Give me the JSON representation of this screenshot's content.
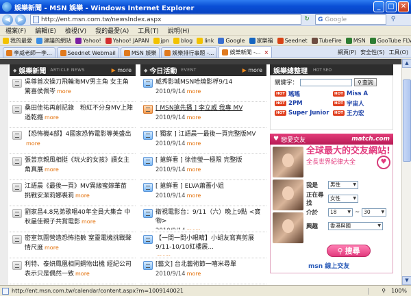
{
  "window": {
    "title": "娛樂新聞 - MSN 娛樂 - Windows Internet Explorer"
  },
  "address": {
    "url": "http://ent.msn.com.tw/newsIndex.aspx",
    "search_placeholder": "Google"
  },
  "menu": [
    "檔案(F)",
    "編輯(E)",
    "檢視(V)",
    "我的最愛(A)",
    "工具(T)",
    "說明(H)"
  ],
  "links": [
    {
      "label": "我的最愛",
      "color": "#f2c200"
    },
    {
      "label": "建議的網站",
      "color": "#3a8ee6"
    },
    {
      "label": "Yahoo!",
      "color": "#7b1fa2"
    },
    {
      "label": "Yahoo! JAPAN",
      "color": "#d32f2f"
    },
    {
      "label": "jpn",
      "color": "#f2c200"
    },
    {
      "label": "blog",
      "color": "#f2c200"
    },
    {
      "label": "link",
      "color": "#f2c200"
    },
    {
      "label": "Google",
      "color": "#3a6fd0"
    },
    {
      "label": "家樂福",
      "color": "#1565c0"
    },
    {
      "label": "Seednet",
      "color": "#d84315"
    },
    {
      "label": "TubeFire",
      "color": "#6d4c41"
    },
    {
      "label": "MSN",
      "color": "#2e7d32"
    },
    {
      "label": "GooTube FLV",
      "color": "#2e7d32"
    }
  ],
  "tabs": [
    {
      "label": "李威老師一李...",
      "active": false
    },
    {
      "label": "Seednet Webmail",
      "active": false
    },
    {
      "label": "MSN 娛樂",
      "active": false
    },
    {
      "label": "娛樂排行事題 -...",
      "active": false
    },
    {
      "label": "娛樂新聞 -...",
      "active": true
    }
  ],
  "tabtools": [
    "網頁(P)",
    "安全性(S)",
    "工具(O)"
  ],
  "news": {
    "title": "娛樂新聞",
    "sub": "ARTICLE NEWS",
    "more": "more",
    "items": [
      {
        "title": "吳尊首次操刀飛輪海MV男主角 女主角驚喜侯佩岑",
        "icon": "grey"
      },
      {
        "title": "桑田佳祐再創記錄　粉紅不分身MV上陣過乾癮",
        "icon": "grey"
      },
      {
        "title": "【恐怖機4部】4國家恐怖電影等美盛出",
        "icon": "grey"
      },
      {
        "title": "張芸京親風相挺《玩火的女孩》讀女主角真展",
        "icon": "grey"
      },
      {
        "title": "江語晨《最後一頁》MV異緣蜜嫁華苗 挑戰安潔莉娜裘莉",
        "icon": "grey"
      },
      {
        "title": "劉家昌4.8兄弟歌唱40年全員大集合 中秋最佳親子共賞電影",
        "icon": "grey"
      },
      {
        "title": "密室氛圍營造恐怖指數 窒靈電機挑戰聲情尺度",
        "icon": "grey"
      },
      {
        "title": "利特、泰妍鳳凰相同鋼物出機 經紀公司表示只是偶然一致",
        "icon": "grey"
      }
    ]
  },
  "events": {
    "title": "今日活動",
    "sub": "EVENT",
    "more": "more",
    "items": [
      {
        "title": "威秀影城MSN哈燒影桴9/14",
        "date": "2010/9/14",
        "icon": "blue",
        "link": false
      },
      {
        "title": "[ MSN搶先播 ] 李立威 我專 MV",
        "date": "2010/9/14",
        "icon": "orange",
        "link": true
      },
      {
        "title": "[ 獨家 ] 江語晨一最後一頁完整版MV",
        "date": "2010/9/14",
        "icon": "blue",
        "link": false
      },
      {
        "title": "[ 搶鮮看 ] 徐佳瑩一極限 完整版",
        "date": "2010/9/14",
        "icon": "blue",
        "link": false
      },
      {
        "title": "[ 搶鮮看 ] ELVA蕭薔小姐",
        "date": "2010/9/14",
        "icon": "blue",
        "link": false
      },
      {
        "title": "衛視電影台：9/11（六）晚上9點 <寶物>",
        "date": "2010/9/14",
        "icon": "blue",
        "link": false
      },
      {
        "title": "【一問一問小眼睛】小胡友寫真剪展9/11-10/10紅樓展...",
        "date": "",
        "icon": "blue",
        "link": false
      },
      {
        "title": "[藝文] 台北藝術節一嘻米尋單",
        "date": "2010/9/14",
        "icon": "blue",
        "link": false
      }
    ]
  },
  "ent": {
    "title": "娛樂總整理",
    "sub": "HOT SEO",
    "kw_label": "關鍵字：",
    "kw_btn": "查詢",
    "hot_badge": "HOT",
    "hot": [
      "瑤瑤",
      "Miss A",
      "2PM",
      "宇宙人",
      "Super Junior",
      "王力宏"
    ]
  },
  "match": {
    "title": "戀愛交友",
    "brand": "match.com",
    "big": "全球最大的交友網站!",
    "sub": "全長世界紀律大全",
    "i_am_label": "我是",
    "i_am": "男性",
    "seek_label": "正在尋找",
    "seek": "女性",
    "age_label": "介於",
    "age_from": "18",
    "age_to": "30",
    "region_label": "興趣",
    "region": "香港與國",
    "search_btn": "搜尋",
    "footer": "msn 線上交友"
  },
  "status": {
    "url": "http://ent.msn.com.tw/calendar/content.aspx?m=1009140021",
    "zone": "",
    "zoom": "100%"
  }
}
